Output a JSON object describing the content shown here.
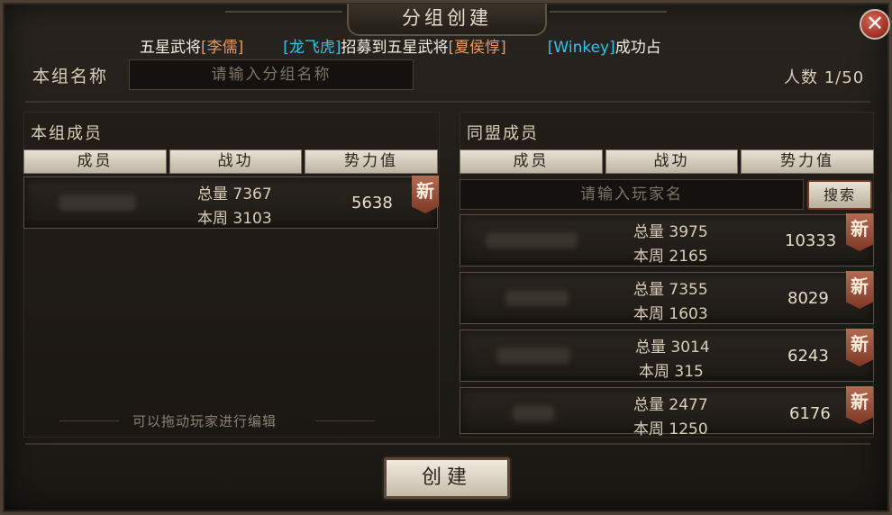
{
  "dialog": {
    "title": "分组创建"
  },
  "ticker": {
    "seg1": "五星武将",
    "seg2": "[李儒]",
    "seg3": "[龙飞虎]",
    "seg4": "招募到五星武将",
    "seg5": "[夏侯惇]",
    "seg6": "[Winkey]",
    "seg7": "成功占"
  },
  "group": {
    "name_label": "本组名称",
    "name_placeholder": "请输入分组名称",
    "count_label": "人数 1/50"
  },
  "left_panel": {
    "title": "本组成员",
    "headers": [
      "成员",
      "战功",
      "势力值"
    ],
    "rows": [
      {
        "total": "总量 7367",
        "weekly": "本周 3103",
        "power": "5638",
        "badge": "新"
      }
    ],
    "hint": "可以拖动玩家进行编辑"
  },
  "right_panel": {
    "title": "同盟成员",
    "headers": [
      "成员",
      "战功",
      "势力值"
    ],
    "search_placeholder": "请输入玩家名",
    "search_button": "搜索",
    "rows": [
      {
        "total": "总量 3975",
        "weekly": "本周 2165",
        "power": "10333",
        "badge": "新"
      },
      {
        "total": "总量 7355",
        "weekly": "本周 1603",
        "power": "8029",
        "badge": "新"
      },
      {
        "total": "总量 3014",
        "weekly": "本周 315",
        "power": "6243",
        "badge": "新"
      },
      {
        "total": "总量 2477",
        "weekly": "本周 1250",
        "power": "6176",
        "badge": "新"
      }
    ]
  },
  "actions": {
    "create": "创建",
    "close_icon": "close-icon"
  },
  "colors": {
    "name_highlight": "#e69a64",
    "player_highlight": "#33c4e8",
    "badge": "#9a4a34"
  }
}
